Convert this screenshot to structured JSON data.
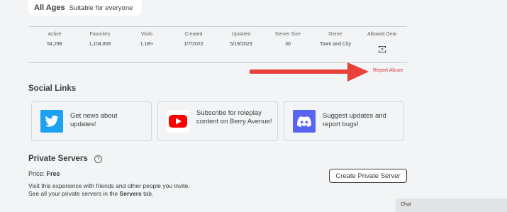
{
  "age_rating": {
    "title": "All Ages",
    "description": "Suitable for everyone"
  },
  "stats": [
    {
      "label": "Active",
      "value": "54,298"
    },
    {
      "label": "Favorites",
      "value": "1,104,806"
    },
    {
      "label": "Visits",
      "value": "1.1B+"
    },
    {
      "label": "Created",
      "value": "1/7/2022"
    },
    {
      "label": "Updated",
      "value": "5/19/2023"
    },
    {
      "label": "Server Size",
      "value": "30"
    },
    {
      "label": "Genre",
      "value": "Town and City"
    },
    {
      "label": "Allowed Gear",
      "value": ""
    }
  ],
  "report_abuse": "Report Abuse",
  "social": {
    "title": "Social Links",
    "links": [
      {
        "platform": "twitter-icon",
        "text": "Get news about updates!",
        "color": "#1da1f2"
      },
      {
        "platform": "youtube-icon",
        "text": "Subscribe for roleplay content on Berry Avenue!",
        "color": "#ff0000"
      },
      {
        "platform": "discord-icon",
        "text": "Suggest updates and report bugs!",
        "color": "#5865f2"
      }
    ]
  },
  "private_servers": {
    "title": "Private Servers",
    "price_label": "Price:",
    "price_value": "Free",
    "desc_line1": "Visit this experience with friends and other people you invite.",
    "desc_line2_a": "See all your private servers in the",
    "desc_line2_b": "Servers",
    "desc_line2_c": "tab.",
    "create_button": "Create Private Server"
  },
  "chat": {
    "label": "Chat"
  },
  "colors": {
    "arrow": "#e8403a",
    "report": "#e0393e"
  }
}
